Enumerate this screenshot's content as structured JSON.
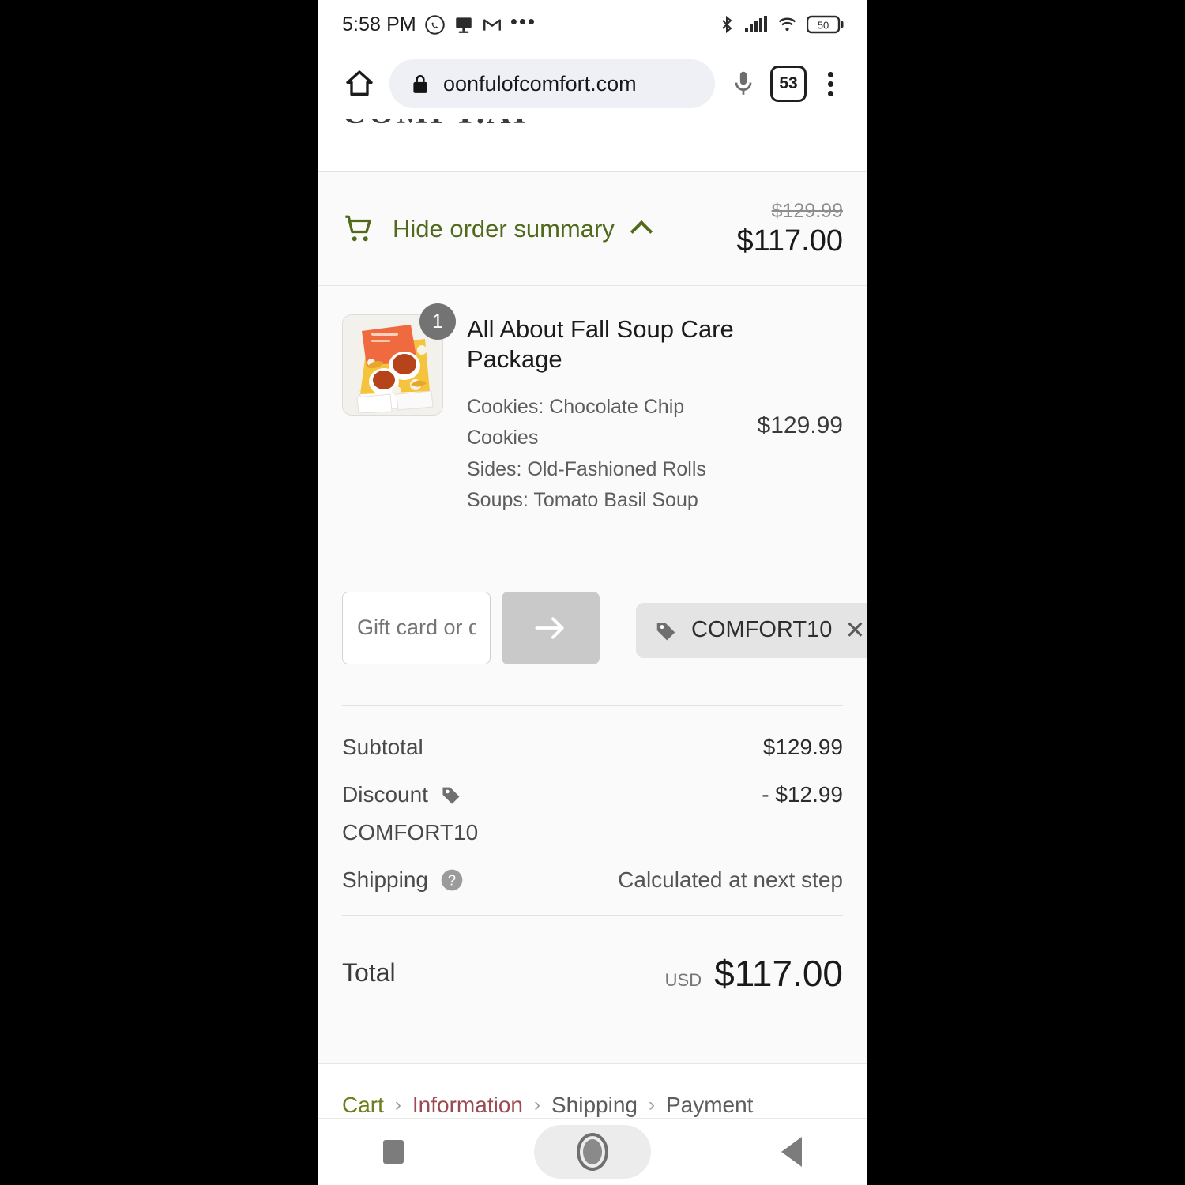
{
  "status_bar": {
    "time": "5:58 PM",
    "left_icons": [
      "whatsapp-icon",
      "app-icon",
      "gmail-icon",
      "more-dots-icon"
    ],
    "right_icons": [
      "bluetooth-icon",
      "cellular-signal-icon",
      "wifi-icon",
      "battery-icon"
    ],
    "battery_level": "50"
  },
  "browser": {
    "home_icon": "home-icon",
    "lock_icon": "lock-icon",
    "url": "oonfulofcomfort.com",
    "mic_icon": "microphone-icon",
    "tab_count": "53",
    "menu_icon": "overflow-menu-icon"
  },
  "site": {
    "logo_text": "COMFY.AI"
  },
  "order_summary": {
    "cart_icon": "shopping-cart-icon",
    "toggle_label": "Hide order summary",
    "chevron_icon": "chevron-up-icon",
    "original_price": "$129.99",
    "current_price": "$117.00",
    "accent_color": "#50691a"
  },
  "line_items": [
    {
      "quantity": "1",
      "title": "All About Fall Soup Care Package",
      "variants": [
        "Cookies: Chocolate Chip Cookies",
        "Sides: Old-Fashioned Rolls",
        "Soups: Tomato Basil Soup"
      ],
      "price": "$129.99",
      "image_alt": "fall-soup-care-package-photo"
    }
  ],
  "discount": {
    "input_placeholder": "Gift card or discount code",
    "input_value": "",
    "apply_icon": "arrow-right-icon",
    "applied_code": "COMFORT10",
    "tag_icon": "discount-tag-icon",
    "remove_icon": "close-icon"
  },
  "totals": {
    "subtotal_label": "Subtotal",
    "subtotal_value": "$129.99",
    "discount_label": "Discount",
    "discount_tag_icon": "discount-tag-icon",
    "discount_code": "COMFORT10",
    "discount_value": "- $12.99",
    "shipping_label": "Shipping",
    "shipping_help_icon": "help-question-icon",
    "shipping_value": "Calculated at next step",
    "total_label": "Total",
    "total_currency": "USD",
    "total_value": "$117.00"
  },
  "breadcrumb": {
    "cart": "Cart",
    "information": "Information",
    "shipping": "Shipping",
    "payment": "Payment",
    "separator": "›",
    "cart_color": "#6b7f1f",
    "information_color": "#9c4a52"
  },
  "android_nav": {
    "recents_icon": "square-recents-icon",
    "home_icon": "circle-home-icon",
    "back_icon": "triangle-back-icon"
  }
}
